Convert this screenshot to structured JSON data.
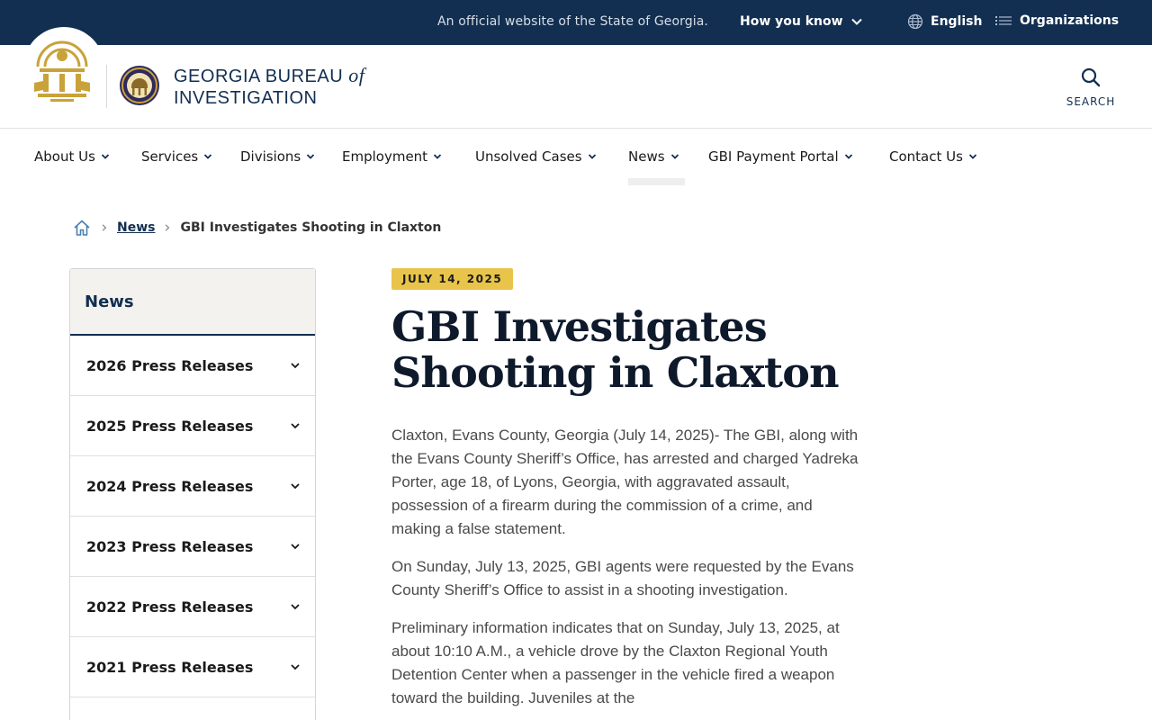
{
  "topbar": {
    "official_text": "An official website of the State of Georgia.",
    "how_you_know": "How you know",
    "language": "English",
    "organizations": "Organizations"
  },
  "header": {
    "agency_line1": "GEORGIA BUREAU",
    "agency_of": "of",
    "agency_line2": "INVESTIGATION",
    "search_label": "SEARCH"
  },
  "nav": {
    "items": [
      {
        "label": "About Us"
      },
      {
        "label": "Services"
      },
      {
        "label": "Divisions"
      },
      {
        "label": "Employment"
      },
      {
        "label": "Unsolved Cases"
      },
      {
        "label": "News"
      },
      {
        "label": "GBI Payment Portal"
      },
      {
        "label": "Contact Us"
      }
    ],
    "active": "News"
  },
  "breadcrumb": {
    "home_icon": "home-icon",
    "section": "News",
    "current": "GBI Investigates Shooting in Claxton"
  },
  "sidebar": {
    "title": "News",
    "items": [
      {
        "label": "2026 Press Releases"
      },
      {
        "label": "2025 Press Releases"
      },
      {
        "label": "2024 Press Releases"
      },
      {
        "label": "2023 Press Releases"
      },
      {
        "label": "2022 Press Releases"
      },
      {
        "label": "2021 Press Releases"
      }
    ]
  },
  "article": {
    "date": "JULY 14, 2025",
    "title_line1": "GBI Investigates",
    "title_line2": "Shooting in Claxton",
    "paragraphs": [
      "Claxton, Evans County, Georgia (July 14, 2025)- The GBI, along with the Evans County Sheriff’s Office, has arrested and charged Yadreka Porter, age 18, of Lyons, Georgia, with aggravated assault, possession of a firearm during the commission of a crime, and making a false statement.",
      "On Sunday, July 13, 2025, GBI agents were requested by the Evans County Sheriff’s Office to assist in a shooting investigation.",
      "Preliminary information indicates that on Sunday, July 13, 2025, at about 10:10 A.M., a vehicle drove by the Claxton Regional Youth Detention Center when a passenger in the vehicle fired a weapon toward the building. Juveniles at the"
    ]
  },
  "colors": {
    "navy": "#122f51",
    "gold": "#e8c54a",
    "sidebar_head_bg": "#f4f2ee"
  }
}
